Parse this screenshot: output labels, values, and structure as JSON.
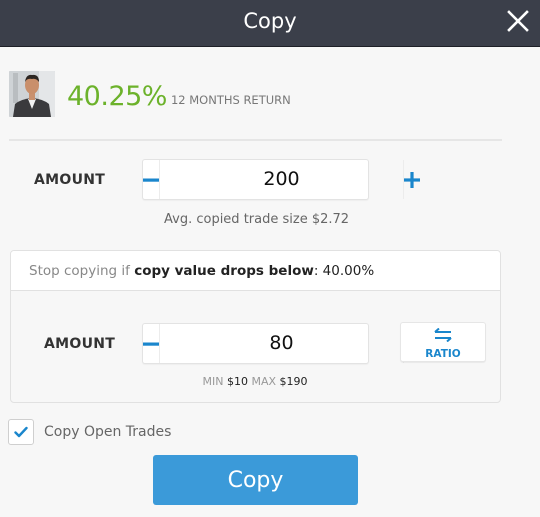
{
  "header": {
    "title": "Copy",
    "close_icon": "close-icon"
  },
  "trader": {
    "avatar": "trader-avatar",
    "return_value": "40.25%",
    "return_label": "12 MONTHS RETURN",
    "return_color": "#6cb22b"
  },
  "amount": {
    "label": "AMOUNT",
    "value": "200",
    "decrement_icon": "minus-icon",
    "increment_icon": "plus-icon",
    "hint": "Avg. copied trade size $2.72"
  },
  "stop_loss": {
    "prefix": "Stop copying if ",
    "emphasis": "copy value drops below",
    "suffix": ": 40.00%",
    "amount_label": "AMOUNT",
    "amount_value": "80",
    "ratio_label": "RATIO",
    "ratio_icon": "swap-arrows-icon",
    "min_label": "MIN",
    "min_value": "$10",
    "max_label": "MAX",
    "max_value": "$190"
  },
  "copy_open_trades": {
    "label": "Copy Open Trades",
    "checked": true
  },
  "actions": {
    "copy_label": "Copy"
  },
  "colors": {
    "header_bg": "#3b3f4a",
    "accent_blue": "#1a86cc",
    "button_blue": "#3b9ad9"
  }
}
